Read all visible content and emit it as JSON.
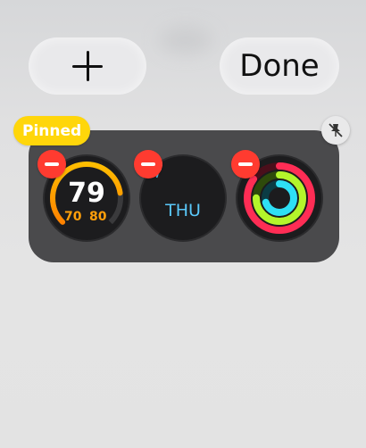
{
  "header": {
    "add_label": "+",
    "done_label": "Done"
  },
  "stack": {
    "pinned_label": "Pinned",
    "complications": [
      {
        "kind": "temperature",
        "current": "79",
        "low": "70",
        "high": "80",
        "level": 0.8
      },
      {
        "kind": "weather",
        "icon": "rain-cloud-icon",
        "day": "THU"
      },
      {
        "kind": "activity-rings",
        "move": 0.85,
        "exercise": 0.75,
        "stand": 0.7
      }
    ]
  },
  "colors": {
    "pinned": "#ffd60a",
    "remove": "#ff3b30",
    "temp_arc": "#ff9f0a",
    "day_text": "#5ac8fa",
    "move_ring": "#ff2d55",
    "exercise_ring": "#b4f52b",
    "stand_ring": "#2ee0f5"
  }
}
